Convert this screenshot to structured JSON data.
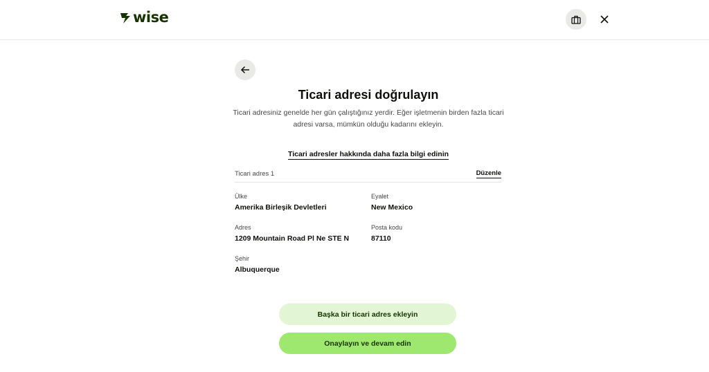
{
  "header": {
    "logo_text": "wise",
    "briefcase_icon": "briefcase-icon",
    "close_icon": "close-icon"
  },
  "main": {
    "back_icon": "arrow-left-icon",
    "title": "Ticari adresi doğrulayın",
    "description": "Ticari adresiniz genelde her gün çalıştığınız yerdir. Eğer işletmenin birden fazla ticari adresi varsa, mümkün olduğu kadarını ekleyin.",
    "learn_more_link": "Ticari adresler hakkında daha fazla bilgi edinin",
    "address_card": {
      "label": "Ticari adres 1",
      "edit_label": "Düzenle",
      "fields": {
        "country": {
          "label": "Ülke",
          "value": "Amerika Birleşik Devletleri"
        },
        "state": {
          "label": "Eyalet",
          "value": "New Mexico"
        },
        "address": {
          "label": "Adres",
          "value": "1209 Mountain Road Pl Ne STE N"
        },
        "postcode": {
          "label": "Posta kodu",
          "value": "87110"
        },
        "city": {
          "label": "Şehir",
          "value": "Albuquerque"
        }
      }
    },
    "add_address_button": "Başka bir ticari adres ekleyin",
    "confirm_button": "Onaylayın ve devam edin"
  },
  "colors": {
    "brand_dark": "#163300",
    "brand_green": "#9fe870",
    "light_green": "#e2f6d5"
  }
}
